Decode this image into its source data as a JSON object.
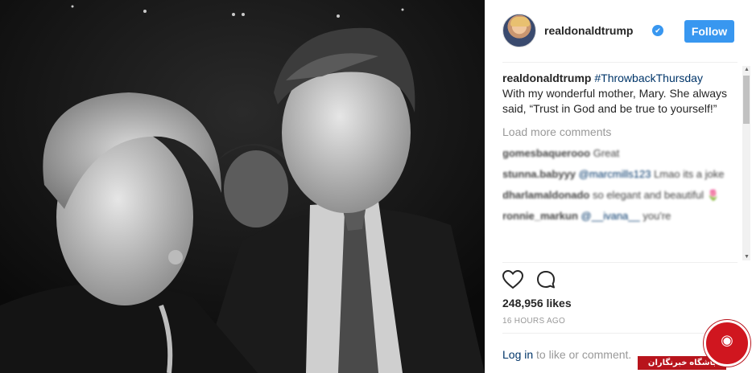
{
  "post": {
    "username": "realdonaldtrump",
    "verified_symbol": "✔",
    "follow_label": "Follow",
    "caption_user": "realdonaldtrump",
    "hashtag": "#ThrowbackThursday",
    "caption_text": "With my wonderful mother, Mary. She always said, “Trust in God and be true to yourself!”",
    "load_more": "Load more comments",
    "comments": [
      {
        "user": "gomesbaquerooo",
        "mention": "",
        "text": "Great"
      },
      {
        "user": "stunna.babyyy",
        "mention": "@marcmills123",
        "text": "Lmao its a joke"
      },
      {
        "user": "dharlamaldonado",
        "mention": "",
        "text": "so elegant and beautiful 🌷"
      },
      {
        "user": "ronnie_markun",
        "mention": "@__ivana__",
        "text": "you're"
      }
    ],
    "likes": "248,956 likes",
    "timestamp": "16 HOURS AGO",
    "login_link": "Log in",
    "login_rest": " to like or comment."
  },
  "watermark": {
    "bar_text": "باشگاه خبرنگاران"
  },
  "icons": {
    "heart": "heart-icon",
    "comment": "comment-icon",
    "verified": "verified-badge-icon"
  },
  "colors": {
    "accent": "#3897f0",
    "link": "#003569",
    "muted": "#999999",
    "watermark_red": "#d0161f"
  }
}
